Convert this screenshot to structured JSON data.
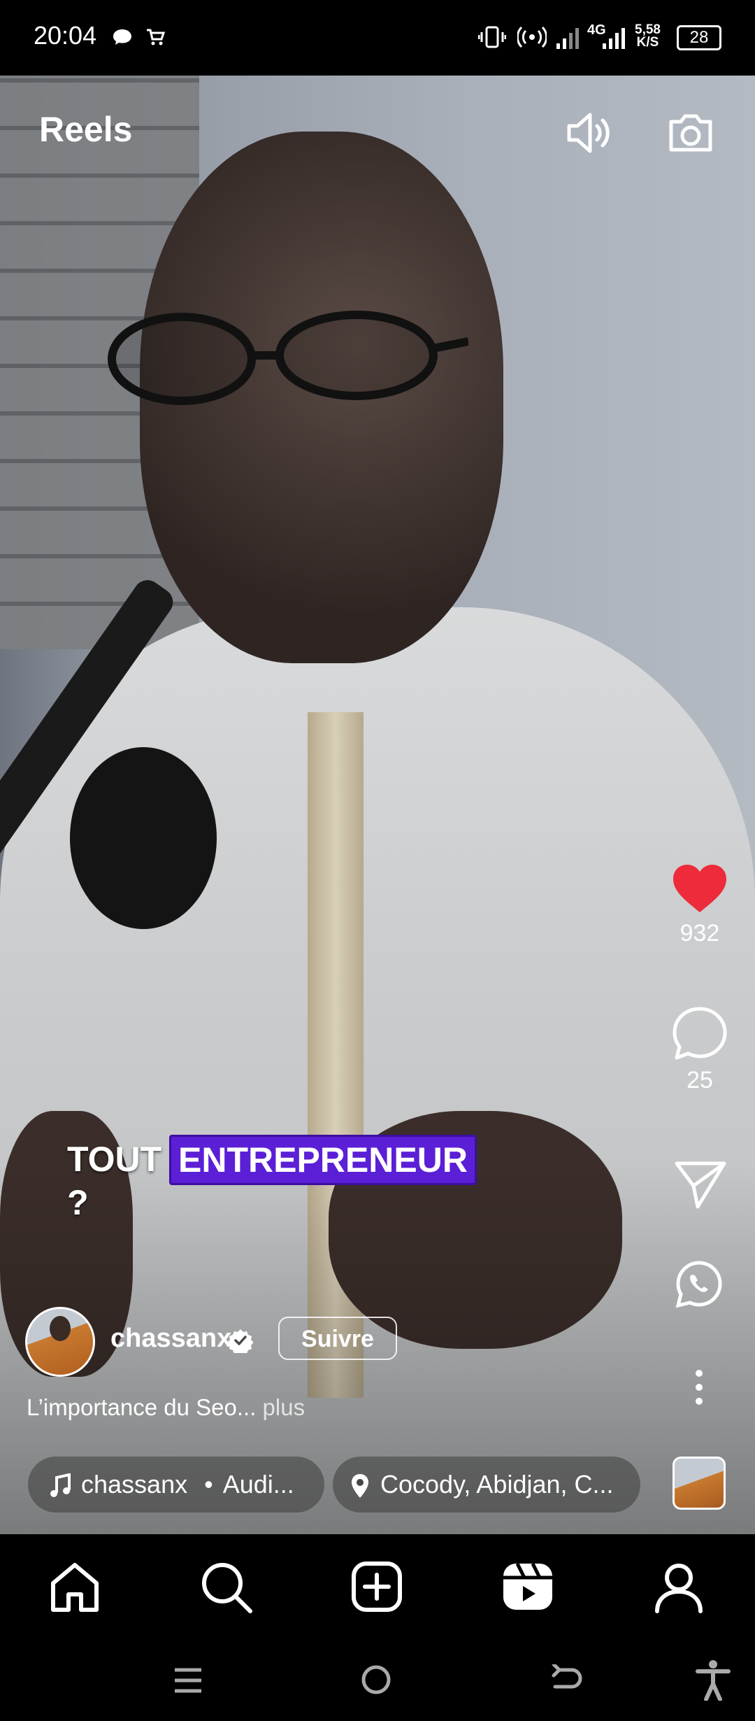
{
  "status_bar": {
    "time": "20:04",
    "network": "4G",
    "speed_value": "5,58",
    "speed_unit": "K/S",
    "battery": "28"
  },
  "header": {
    "title": "Reels",
    "sound_icon": "speaker-icon",
    "camera_icon": "camera-icon"
  },
  "video": {
    "caption_word1": "TOUT",
    "caption_word2": "ENTREPRENEUR",
    "caption_line2": "?"
  },
  "actions": {
    "like_count": "932",
    "comment_count": "25",
    "like_color": "#ed2b3b"
  },
  "account": {
    "username": "chassanx",
    "follow_label": "Suivre",
    "description": "L’importance du Seo...",
    "more_label": "plus"
  },
  "audio": {
    "artist": "chassanx",
    "separator": "•",
    "track": "Audi..."
  },
  "location": {
    "label": "Cocody, Abidjan, C..."
  },
  "bottom_nav": [
    "home-icon",
    "search-icon",
    "create-icon",
    "reels-icon",
    "profile-icon"
  ]
}
